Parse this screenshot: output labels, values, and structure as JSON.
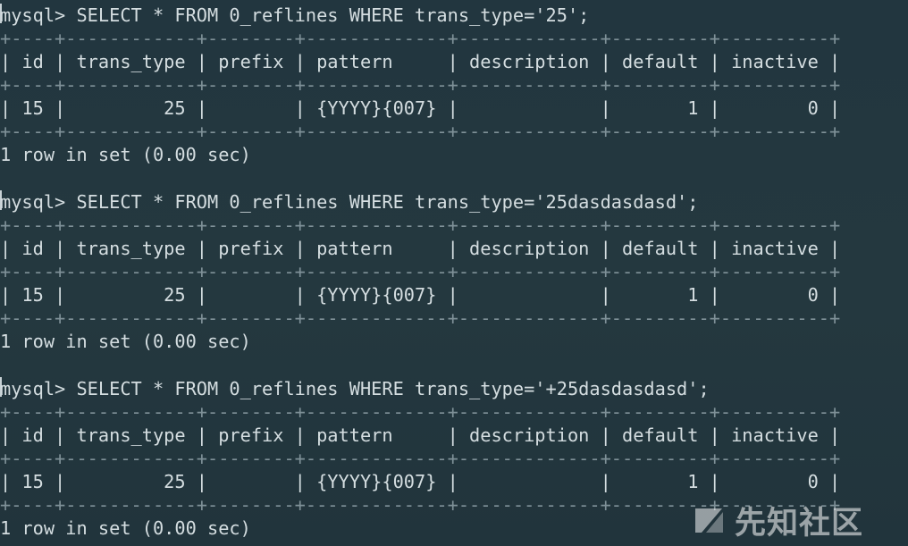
{
  "terminal": {
    "blocks": [
      {
        "command": "mysql> SELECT * FROM 0_reflines WHERE trans_type='25';",
        "top_border": "+----+------------+--------+-------------+-------------+---------+----------+",
        "header": "| id | trans_type | prefix | pattern     | description | default | inactive |",
        "middle_border": "+----+------------+--------+-------------+-------------+---------+----------+",
        "row": "| 15 |         25 |        | {YYYY}{007} |             |       1 |        0 |",
        "bottom_border": "+----+------------+--------+-------------+-------------+---------+----------+",
        "result": "1 row in set (0.00 sec)"
      },
      {
        "command": "mysql> SELECT * FROM 0_reflines WHERE trans_type='25dasdasdasd';",
        "top_border": "+----+------------+--------+-------------+-------------+---------+----------+",
        "header": "| id | trans_type | prefix | pattern     | description | default | inactive |",
        "middle_border": "+----+------------+--------+-------------+-------------+---------+----------+",
        "row": "| 15 |         25 |        | {YYYY}{007} |             |       1 |        0 |",
        "bottom_border": "+----+------------+--------+-------------+-------------+---------+----------+",
        "result": "1 row in set (0.00 sec)"
      },
      {
        "command": "mysql> SELECT * FROM 0_reflines WHERE trans_type='+25dasdasdasd';",
        "top_border": "+----+------------+--------+-------------+-------------+---------+----------+",
        "header": "| id | trans_type | prefix | pattern     | description | default | inactive |",
        "middle_border": "+----+------------+--------+-------------+-------------+---------+----------+",
        "row": "| 15 |         25 |        | {YYYY}{007} |             |       1 |        0 |",
        "bottom_border": "+----+------------+--------+-------------+-------------+---------+----------+",
        "result": "1 row in set (0.00 sec)"
      }
    ]
  },
  "watermark": {
    "text": "先知社区",
    "icon": "xianzhi-logo-icon"
  },
  "colors": {
    "background": "#23373f",
    "text": "#d4dde0",
    "border": "#7f9198",
    "watermark": "#f5f5f5"
  }
}
